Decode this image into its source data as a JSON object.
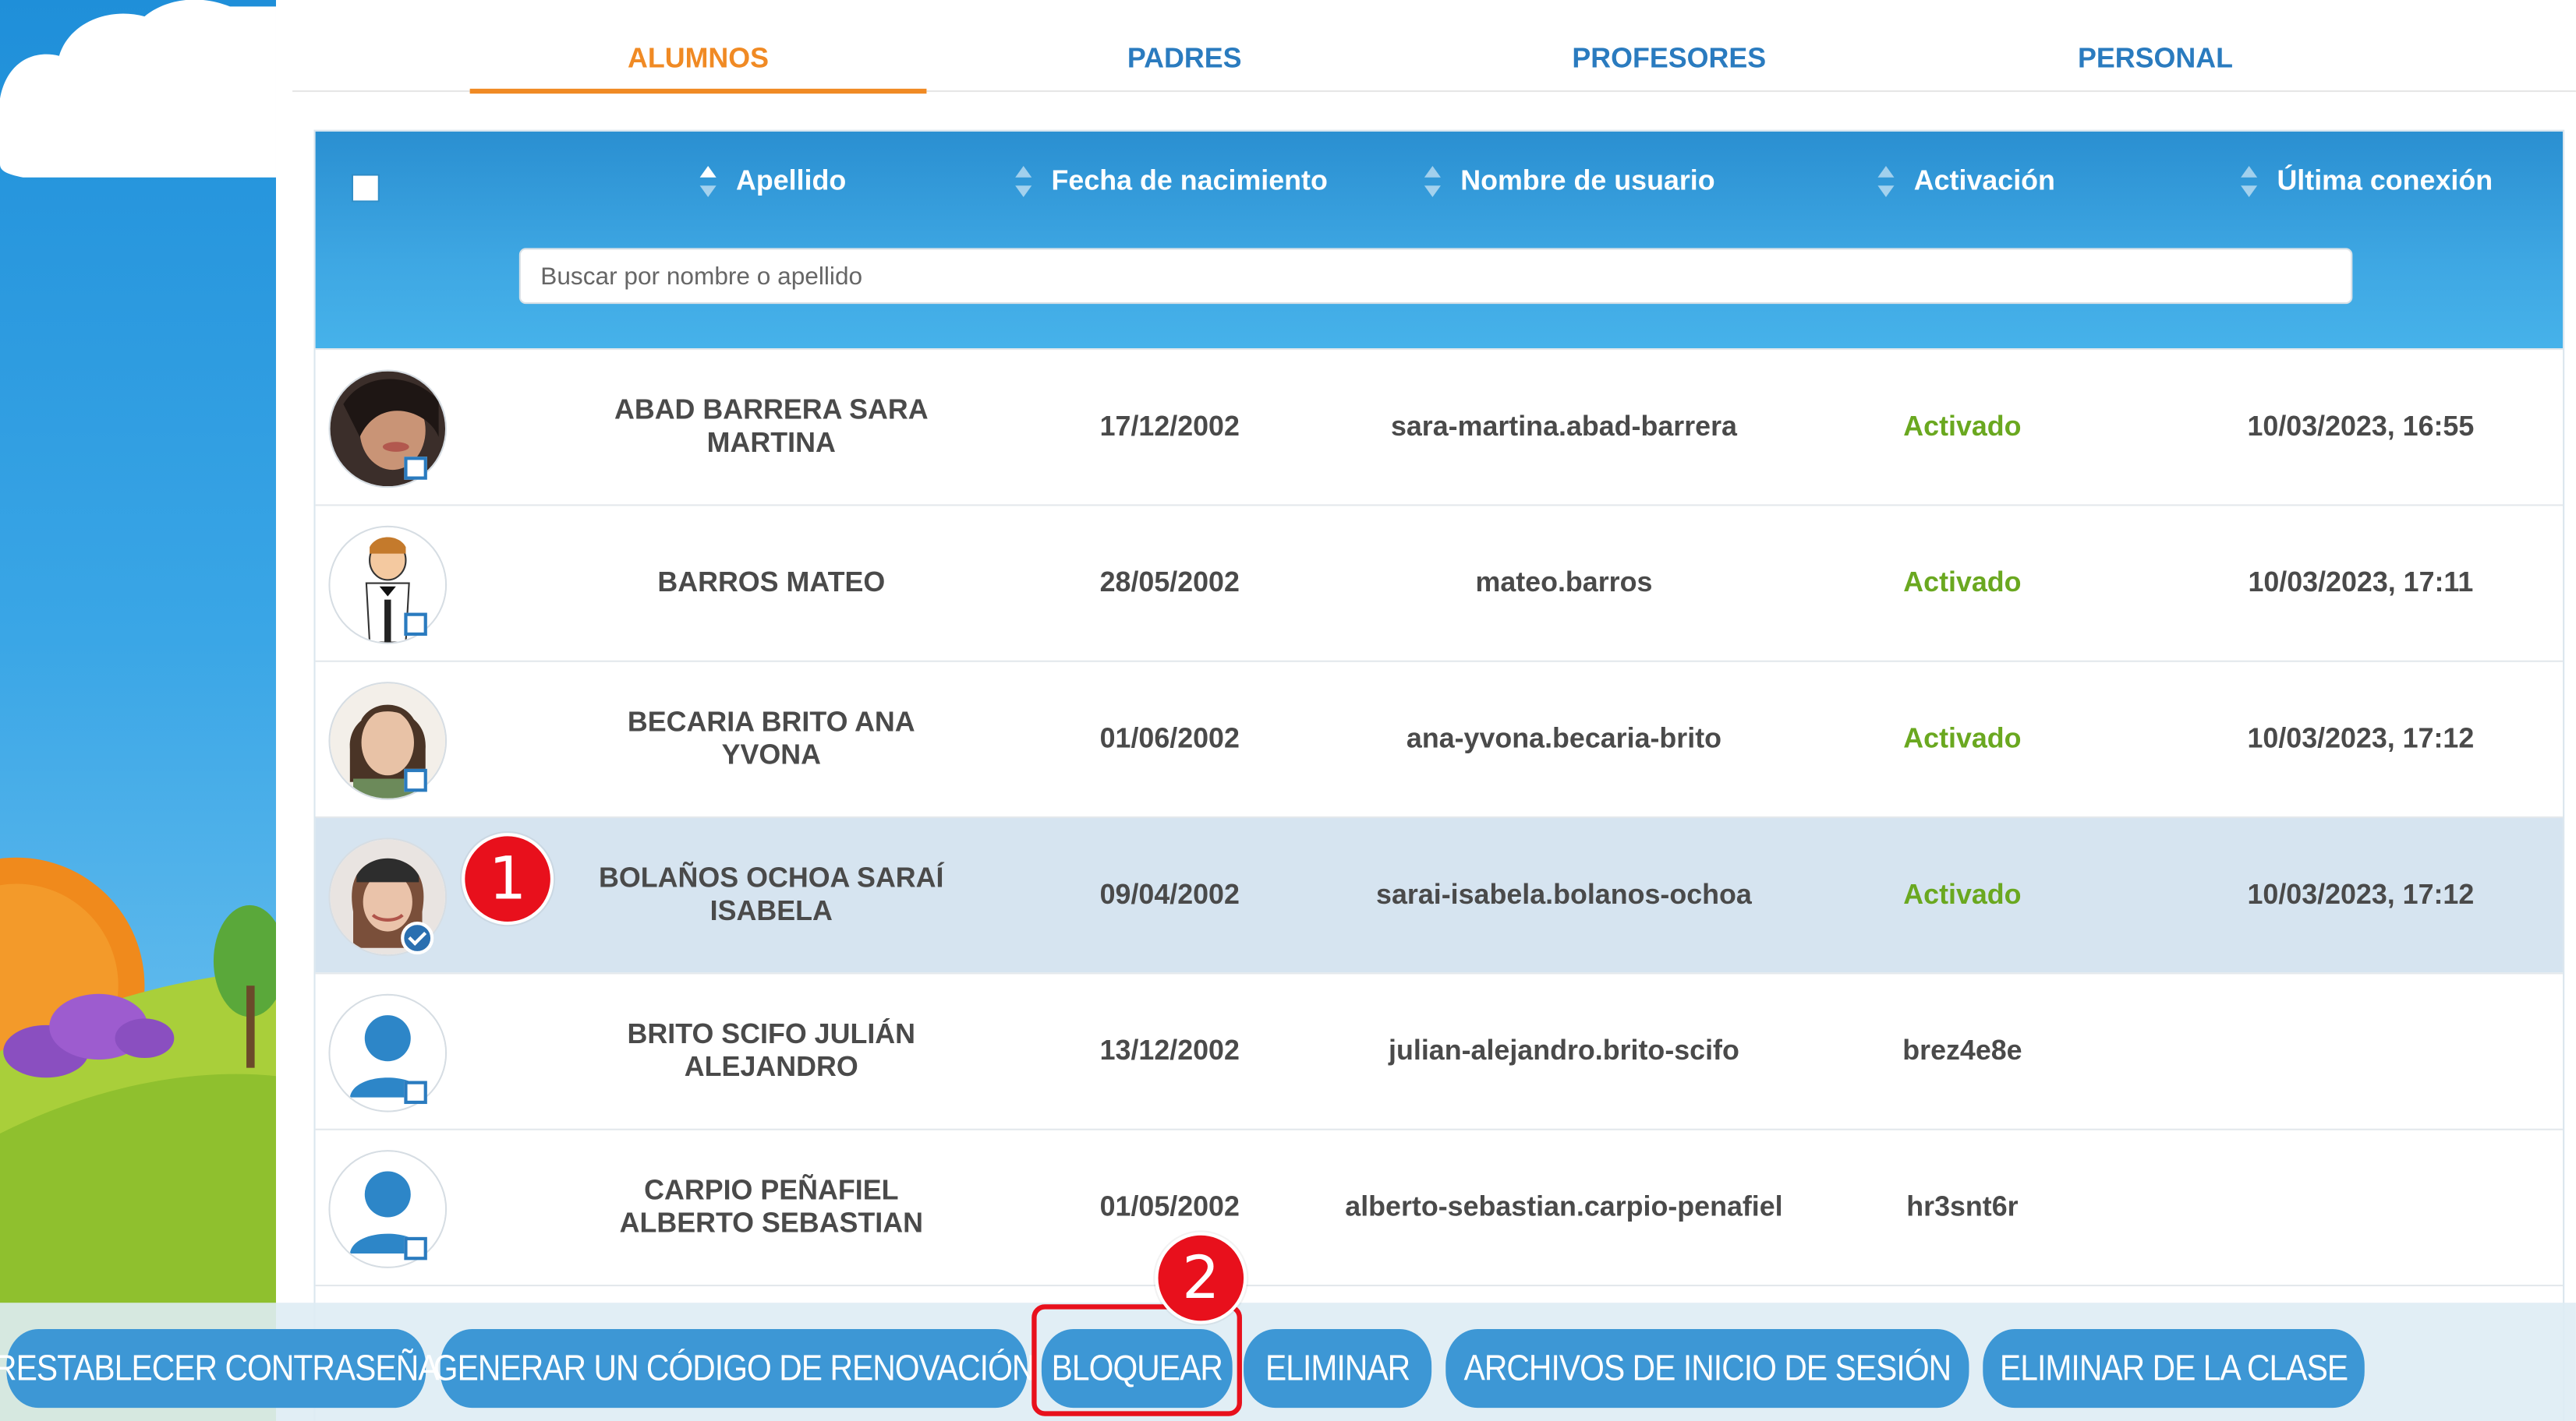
{
  "tabs": [
    {
      "label": "ALUMNOS",
      "active": true
    },
    {
      "label": "PADRES",
      "active": false
    },
    {
      "label": "PROFESORES",
      "active": false
    },
    {
      "label": "PERSONAL",
      "active": false
    }
  ],
  "table": {
    "columns": [
      "Apellido",
      "Fecha de nacimiento",
      "Nombre de usuario",
      "Activación",
      "Última conexión"
    ],
    "search_placeholder": "Buscar por nombre o apellido",
    "rows": [
      {
        "name": "ABAD BARRERA SARA MARTINA",
        "birth": "17/12/2002",
        "username": "sara-martina.abad-barrera",
        "activation": "Activado",
        "last": "10/03/2023, 16:55",
        "avatar": "photo-woman-dark-hair",
        "selected": false
      },
      {
        "name": "BARROS MATEO",
        "birth": "28/05/2002",
        "username": "mateo.barros",
        "activation": "Activado",
        "last": "10/03/2023, 17:11",
        "avatar": "cartoon-man-tuxedo",
        "selected": false
      },
      {
        "name": "BECARIA BRITO ANA YVONA",
        "birth": "01/06/2002",
        "username": "ana-yvona.becaria-brito",
        "activation": "Activado",
        "last": "10/03/2023, 17:12",
        "avatar": "photo-woman-bangs",
        "selected": false
      },
      {
        "name": "BOLAÑOS OCHOA SARAÍ ISABELA",
        "birth": "09/04/2002",
        "username": "sarai-isabela.bolanos-ochoa",
        "activation": "Activado",
        "last": "10/03/2023, 17:12",
        "avatar": "photo-girl-cap",
        "selected": true
      },
      {
        "name": "BRITO SCIFO JULIÁN ALEJANDRO",
        "birth": "13/12/2002",
        "username": "julian-alejandro.brito-scifo",
        "activation": "brez4e8e",
        "last": "",
        "avatar": "default-user",
        "selected": false
      },
      {
        "name": "CARPIO PEÑAFIEL ALBERTO SEBASTIAN",
        "birth": "01/05/2002",
        "username": "alberto-sebastian.carpio-penafiel",
        "activation": "hr3snt6r",
        "last": "",
        "avatar": "default-user",
        "selected": false
      }
    ]
  },
  "callouts": [
    "1",
    "2"
  ],
  "actions": [
    "RESTABLECER CONTRASEÑA",
    "GENERAR UN CÓDIGO DE RENOVACIÓN",
    "BLOQUEAR",
    "ELIMINAR",
    "ARCHIVOS DE INICIO DE SESIÓN",
    "ELIMINAR DE LA CLASE"
  ],
  "colors": {
    "accent_orange": "#f08a24",
    "tab_blue": "#2a7bbf",
    "header_blue": "#3ea7e3",
    "active_green": "#6aa820",
    "callout_red": "#e8101c",
    "button_blue": "#3d97d5",
    "selected_row": "#d6e4f0"
  }
}
